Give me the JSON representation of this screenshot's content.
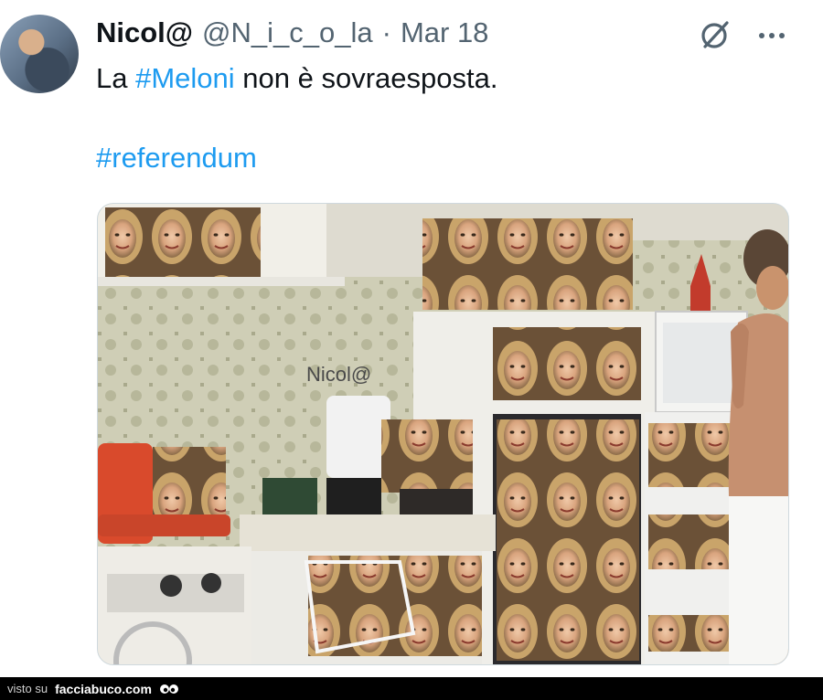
{
  "tweet": {
    "display_name": "Nicol@",
    "handle": "@N_i_c_o_la",
    "separator": "·",
    "date": "Mar 18",
    "text_prefix": "La ",
    "hashtag_1": "#Meloni",
    "text_suffix": " non è sovraesposta.",
    "hashtag_2": "#referendum"
  },
  "media": {
    "watermark": "Nicol@"
  },
  "icons": {
    "avatar": "avatar",
    "grok": "grok-icon",
    "more": "more-icon",
    "eyes": "eyes-icon"
  },
  "footer": {
    "visto_label": "visto su",
    "site_label": "facciabuco.com"
  },
  "colors": {
    "link": "#1d9bf0",
    "secondary_text": "#536471",
    "primary_text": "#0f1419",
    "footer_bg": "#000000"
  }
}
